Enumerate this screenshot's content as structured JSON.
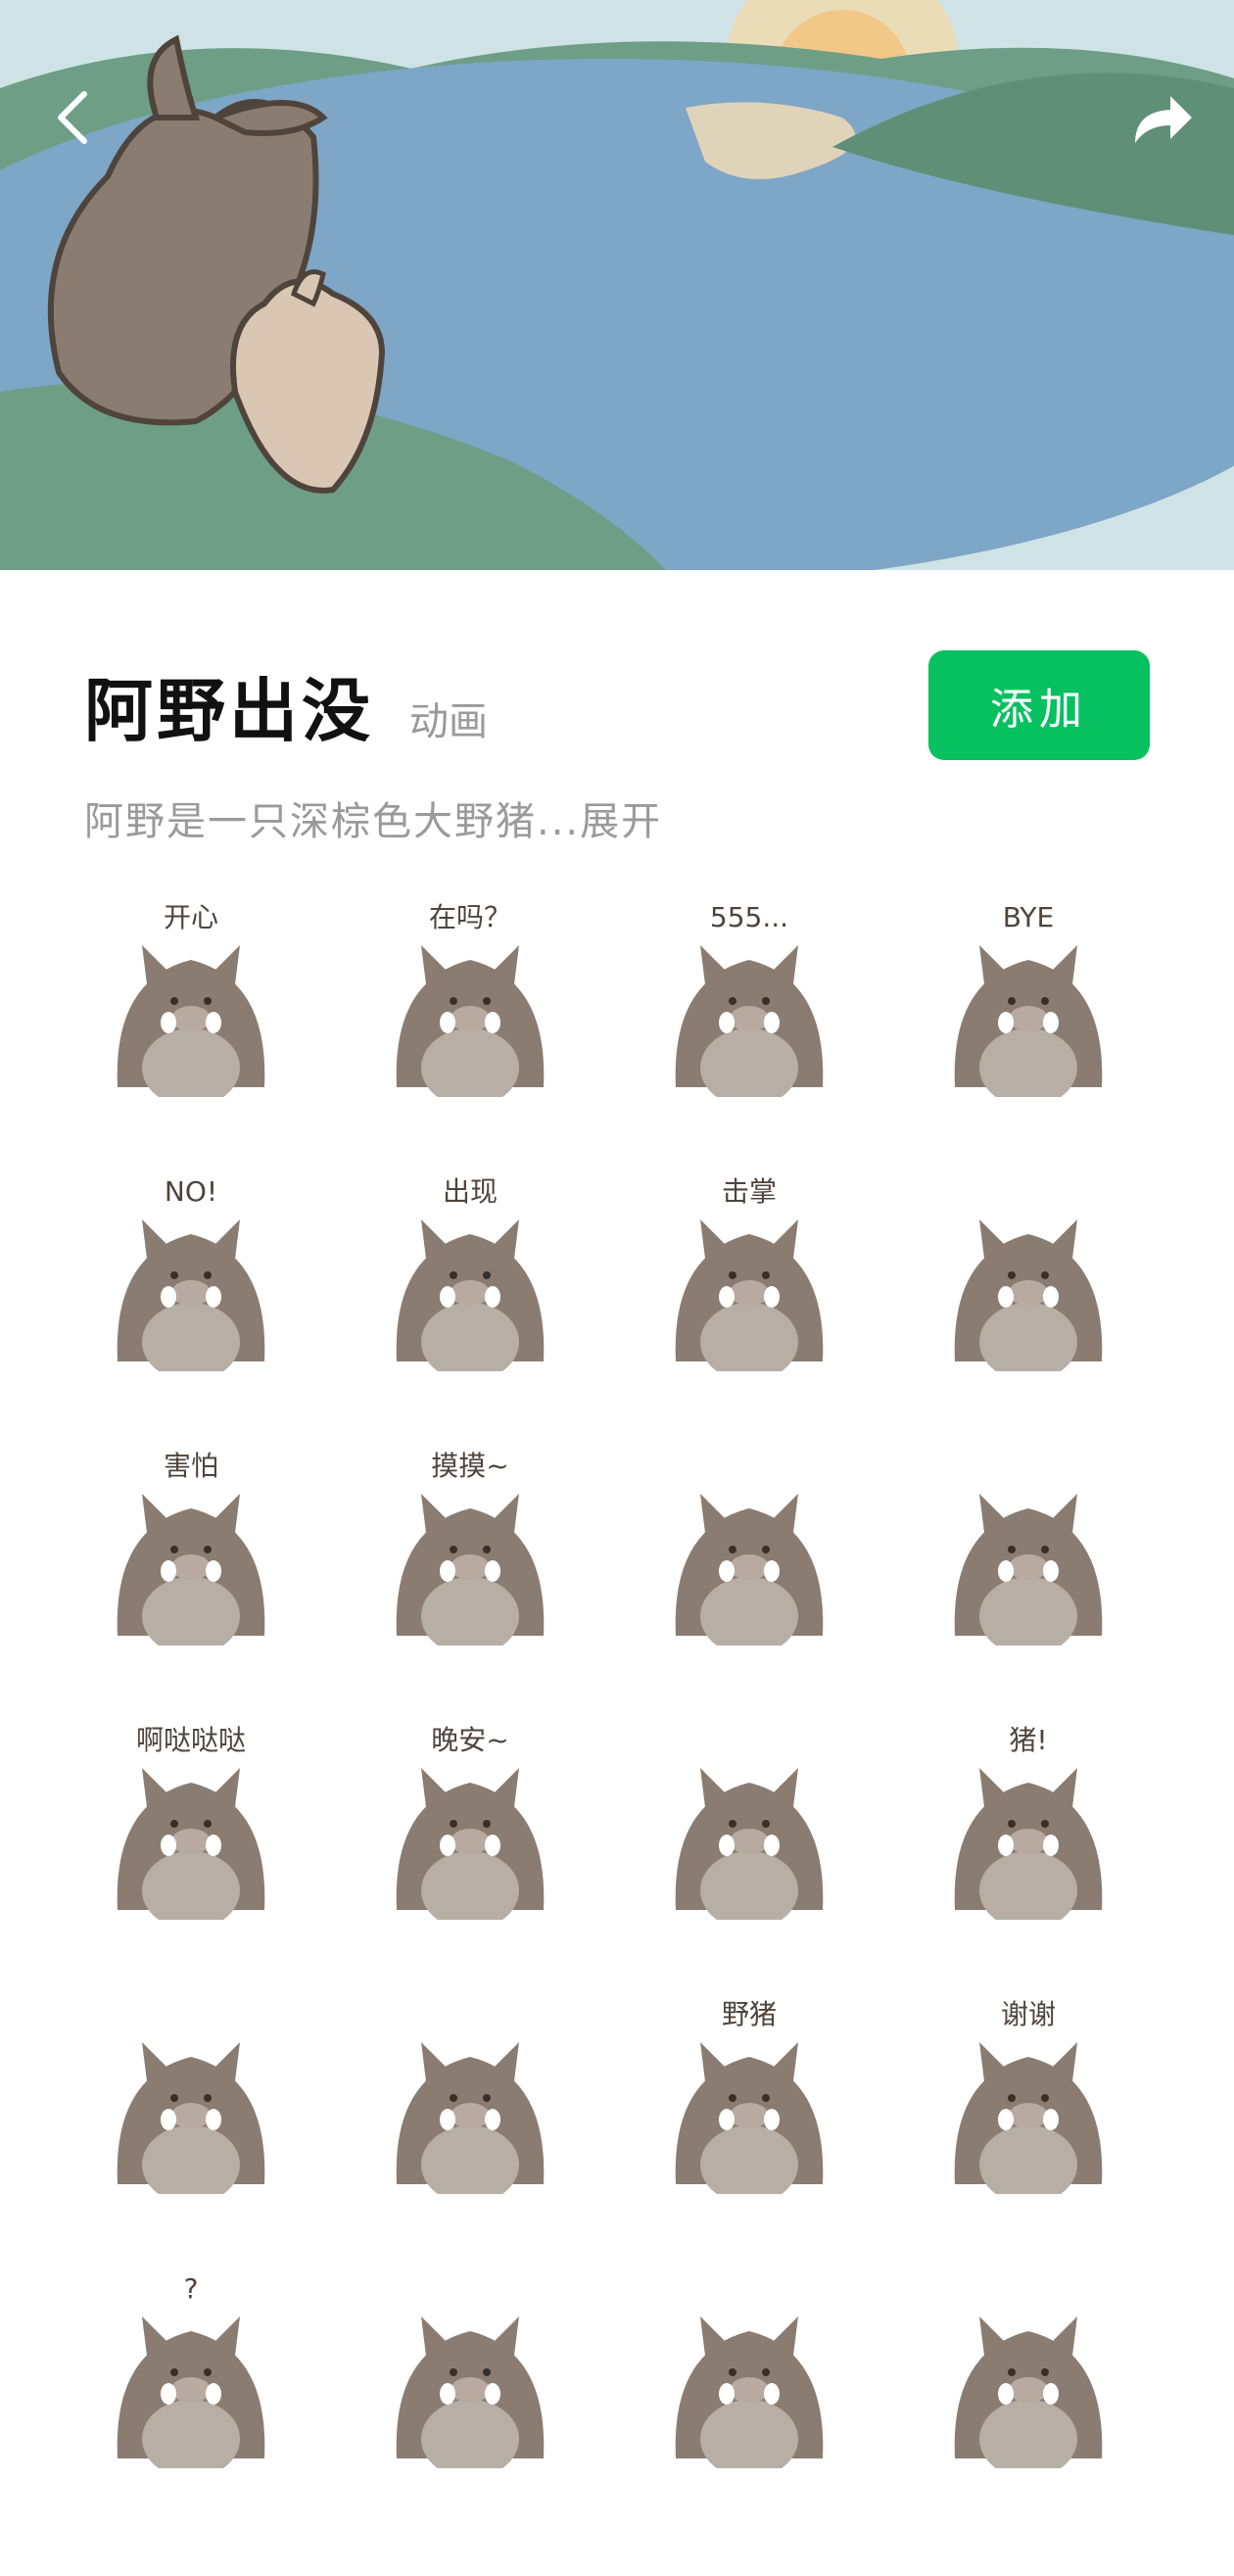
{
  "header": {
    "back_icon": "chevron-left-icon",
    "share_icon": "share-arrow-icon"
  },
  "pack": {
    "title": "阿野出没",
    "type_tag": "动画",
    "add_label": "添加",
    "description": "阿野是一只深棕色大野猪...展开"
  },
  "colors": {
    "accent": "#07c160",
    "boar_dark": "#8a7c70",
    "boar_belly": "#b7aea5",
    "lake": "#7ea6c6"
  },
  "stickers": [
    {
      "caption": "开心"
    },
    {
      "caption": "在吗？"
    },
    {
      "caption": "555..."
    },
    {
      "caption": "BYE"
    },
    {
      "caption": "NO!"
    },
    {
      "caption": "出现"
    },
    {
      "caption": "击掌"
    },
    {
      "caption": ""
    },
    {
      "caption": "害怕"
    },
    {
      "caption": "摸摸~"
    },
    {
      "caption": ""
    },
    {
      "caption": ""
    },
    {
      "caption": "啊哒哒哒"
    },
    {
      "caption": "晚安~"
    },
    {
      "caption": ""
    },
    {
      "caption": "猪!"
    },
    {
      "caption": ""
    },
    {
      "caption": ""
    },
    {
      "caption": "野猪"
    },
    {
      "caption": "谢谢"
    },
    {
      "caption": "?"
    },
    {
      "caption": ""
    },
    {
      "caption": ""
    },
    {
      "caption": ""
    }
  ]
}
